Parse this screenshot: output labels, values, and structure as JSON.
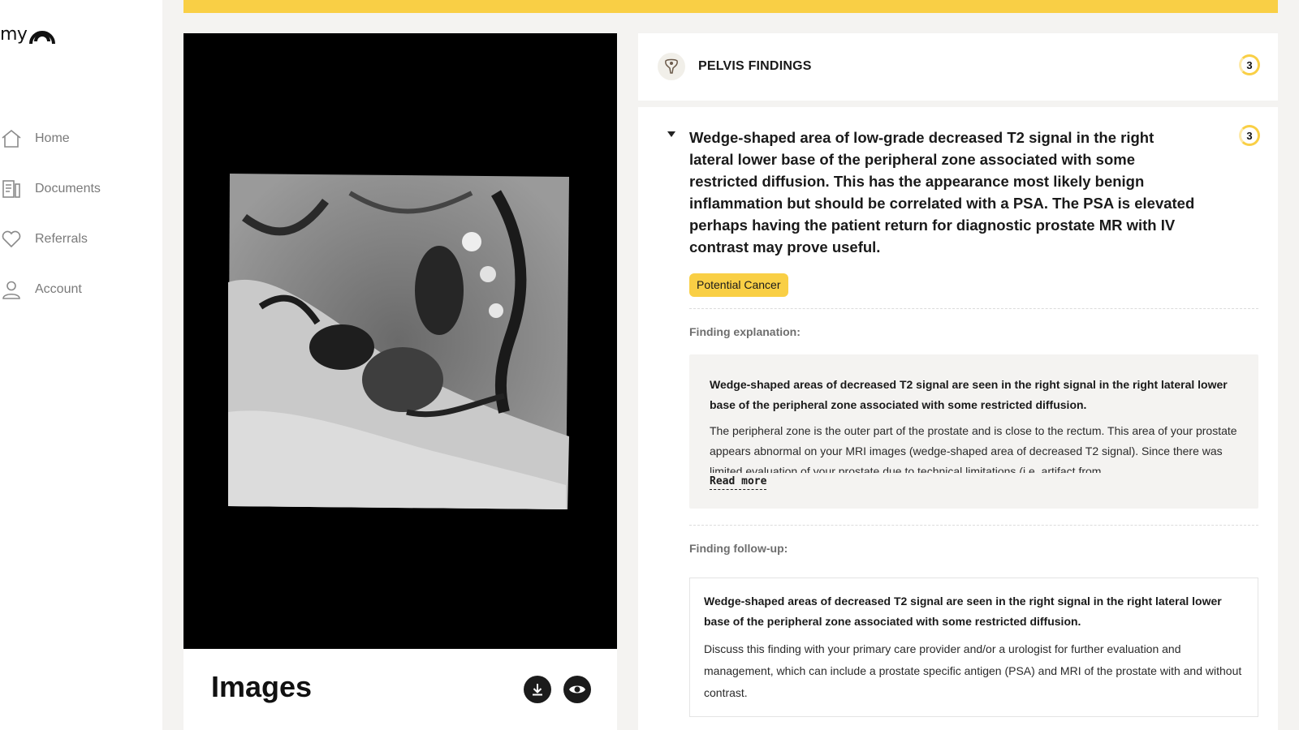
{
  "logo": {
    "text": "my"
  },
  "sidebar": {
    "items": [
      {
        "label": "Home",
        "icon": "home-icon"
      },
      {
        "label": "Documents",
        "icon": "documents-icon"
      },
      {
        "label": "Referrals",
        "icon": "heart-icon"
      },
      {
        "label": "Account",
        "icon": "user-icon"
      }
    ]
  },
  "images": {
    "title": "Images",
    "download_icon": "download-icon",
    "view_icon": "eye-icon"
  },
  "findings": {
    "header_title": "PELVIS FINDINGS",
    "header_count": "3",
    "finding": {
      "title": "Wedge-shaped area of low-grade decreased T2 signal in the right lateral lower base of the peripheral zone associated with some restricted diffusion. This has the appearance most likely benign inflammation but should be correlated with a PSA. The PSA is elevated perhaps having the patient return for diagnostic prostate MR with IV contrast may prove useful.",
      "count": "3",
      "tag": "Potential Cancer",
      "explanation_label": "Finding explanation:",
      "explanation_bold": "Wedge-shaped areas of decreased T2 signal are seen in the right signal in the right lateral lower base of the peripheral zone associated with some restricted diffusion.",
      "explanation_text": "The peripheral zone is the outer part of the prostate and is close to the rectum. This area of your prostate appears abnormal on your MRI images (wedge-shaped area of decreased T2 signal). Since there was limited evaluation of your prostate due to technical limitations (i.e. artifact from",
      "read_more": "Read more",
      "followup_label": "Finding follow-up:",
      "followup_bold": "Wedge-shaped areas of decreased T2 signal are seen in the right signal in the right lateral lower base of the peripheral zone associated with some restricted diffusion.",
      "followup_text": "Discuss this finding with your primary care provider and/or a urologist for further evaluation and management, which can include a prostate specific antigen (PSA) and MRI of the prostate with and without contrast."
    }
  },
  "colors": {
    "accent": "#f9cf45",
    "background": "#f4f3f1",
    "text": "#1a1a1a"
  }
}
